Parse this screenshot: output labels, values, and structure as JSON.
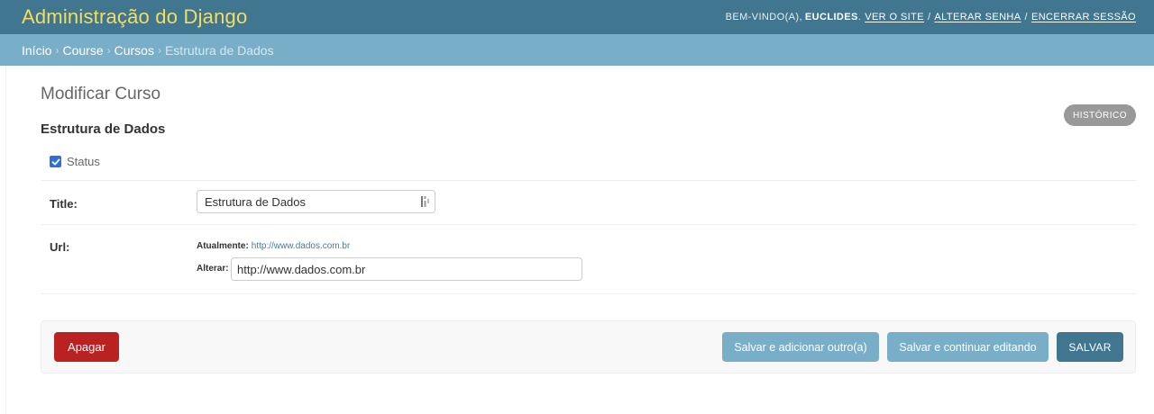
{
  "header": {
    "site_title": "Administração do Django",
    "welcome": "Bem-vindo(a),",
    "username": "Euclides",
    "view_site": "Ver o site",
    "change_password": "Alterar senha",
    "logout": "Encerrar sessão",
    "colors": {
      "background": "#417690",
      "title": "#f5dd5d"
    }
  },
  "breadcrumbs": {
    "items": [
      "Início",
      "Course",
      "Cursos"
    ],
    "current": "Estrutura de Dados"
  },
  "page": {
    "title": "Modificar Curso",
    "object_name": "Estrutura de Dados",
    "history_label": "Histórico"
  },
  "form": {
    "status": {
      "label": "Status",
      "checked": true
    },
    "title_field": {
      "label": "Title:",
      "value": "Estrutura de Dados",
      "icon": "password-manager-icon"
    },
    "url_field": {
      "label": "Url:",
      "current_label": "Atualmente:",
      "current_value": "http://www.dados.com.br",
      "change_label": "Alterar:",
      "value": "http://www.dados.com.br"
    }
  },
  "actions": {
    "delete": "Apagar",
    "save_add": "Salvar e adicionar outro(a)",
    "save_continue": "Salvar e continuar editando",
    "save": "Salvar",
    "colors": {
      "delete": "#ba2121",
      "secondary": "#79aec8",
      "primary": "#417690"
    }
  }
}
